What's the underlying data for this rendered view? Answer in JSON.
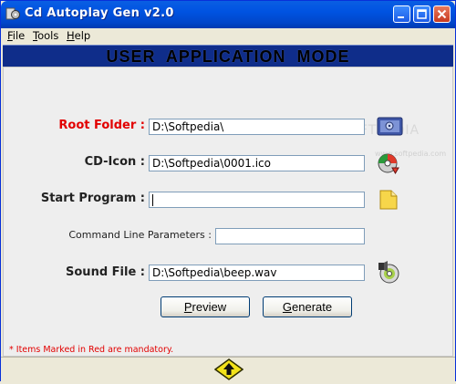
{
  "window": {
    "title": "Cd Autoplay Gen v2.0"
  },
  "menu": {
    "items": [
      {
        "underline": "F",
        "rest": "ile"
      },
      {
        "underline": "T",
        "rest": "ools"
      },
      {
        "underline": "H",
        "rest": "elp"
      }
    ]
  },
  "banner": {
    "mode_text": "USER  APPLICATION  MODE"
  },
  "form": {
    "root_folder_label": "Root Folder :",
    "root_folder_value": "D:\\Softpedia\\",
    "cd_icon_label": "CD-Icon :",
    "cd_icon_value": "D:\\Softpedia\\0001.ico",
    "start_program_label": "Start Program :",
    "start_program_value": "",
    "cmd_params_label": "Command Line Parameters :",
    "cmd_params_value": "",
    "sound_file_label": "Sound File :",
    "sound_file_value": "D:\\Softpedia\\beep.wav"
  },
  "buttons": {
    "preview": {
      "underline": "P",
      "rest": "review"
    },
    "generate": {
      "underline": "G",
      "rest": "enerate"
    }
  },
  "note": "* Items Marked in Red are mandatory.",
  "watermark": {
    "main": "SOFTPEDIA",
    "sub": "www.softpedia.com"
  },
  "colors": {
    "mandatory_label": "#e20000",
    "banner_bg": "#0f2d8a",
    "titlebar": "#0053e1"
  }
}
